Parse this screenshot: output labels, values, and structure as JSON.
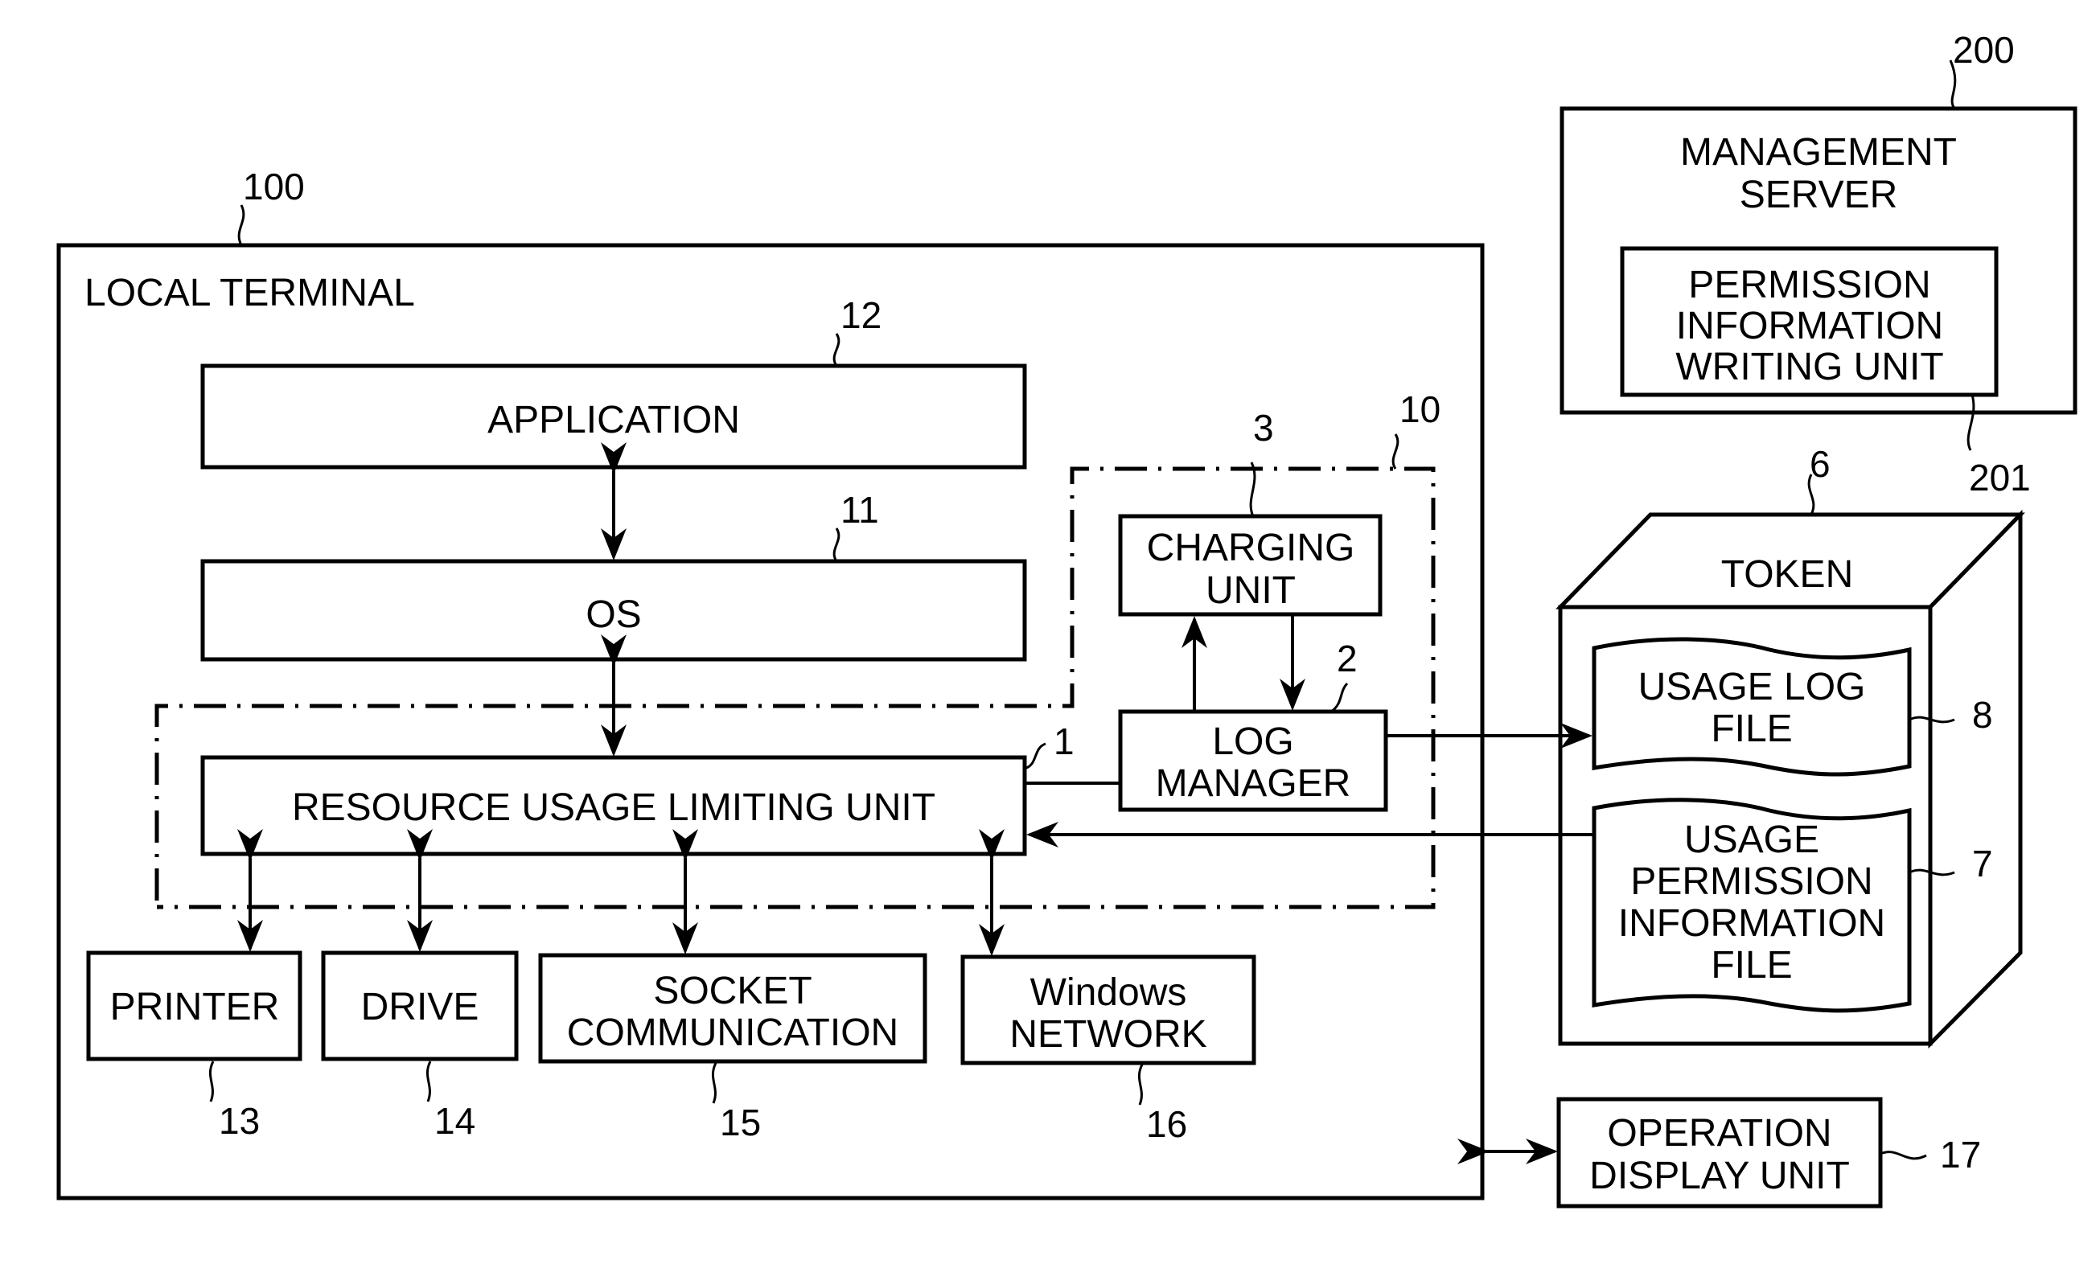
{
  "diagram": {
    "local_terminal": {
      "title": "LOCAL TERMINAL",
      "ref": "100"
    },
    "application": {
      "label": "APPLICATION",
      "ref": "12"
    },
    "os": {
      "label": "OS",
      "ref": "11"
    },
    "resource_unit": {
      "label": "RESOURCE USAGE LIMITING UNIT",
      "ref": "1"
    },
    "group_ref": "10",
    "charging_unit": {
      "lines": [
        "CHARGING",
        "UNIT"
      ],
      "ref": "3"
    },
    "log_manager": {
      "lines": [
        "LOG",
        "MANAGER"
      ],
      "ref": "2"
    },
    "printer": {
      "label": "PRINTER",
      "ref": "13"
    },
    "drive": {
      "label": "DRIVE",
      "ref": "14"
    },
    "socket": {
      "lines": [
        "SOCKET",
        "COMMUNICATION"
      ],
      "ref": "15"
    },
    "windows_network": {
      "lines": [
        "Windows",
        "NETWORK"
      ],
      "ref": "16"
    },
    "management_server": {
      "lines": [
        "MANAGEMENT",
        "SERVER"
      ],
      "ref": "200"
    },
    "permission_writer": {
      "lines": [
        "PERMISSION",
        "INFORMATION",
        "WRITING UNIT"
      ],
      "ref": "201"
    },
    "token": {
      "label": "TOKEN",
      "ref": "6"
    },
    "usage_log_file": {
      "lines": [
        "USAGE LOG",
        "FILE"
      ],
      "ref": "8"
    },
    "usage_permission_file": {
      "lines": [
        "USAGE",
        "PERMISSION",
        "INFORMATION",
        "FILE"
      ],
      "ref": "7"
    },
    "operation_display": {
      "lines": [
        "OPERATION",
        "DISPLAY UNIT"
      ],
      "ref": "17"
    }
  }
}
